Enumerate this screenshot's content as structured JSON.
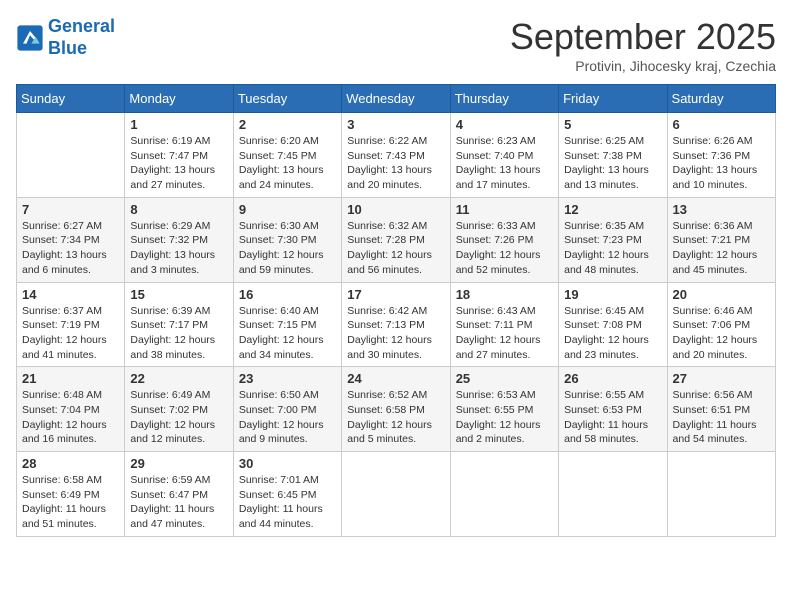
{
  "header": {
    "logo_line1": "General",
    "logo_line2": "Blue",
    "month": "September 2025",
    "location": "Protivin, Jihocesky kraj, Czechia"
  },
  "weekdays": [
    "Sunday",
    "Monday",
    "Tuesday",
    "Wednesday",
    "Thursday",
    "Friday",
    "Saturday"
  ],
  "weeks": [
    [
      {
        "day": "",
        "info": ""
      },
      {
        "day": "1",
        "info": "Sunrise: 6:19 AM\nSunset: 7:47 PM\nDaylight: 13 hours\nand 27 minutes."
      },
      {
        "day": "2",
        "info": "Sunrise: 6:20 AM\nSunset: 7:45 PM\nDaylight: 13 hours\nand 24 minutes."
      },
      {
        "day": "3",
        "info": "Sunrise: 6:22 AM\nSunset: 7:43 PM\nDaylight: 13 hours\nand 20 minutes."
      },
      {
        "day": "4",
        "info": "Sunrise: 6:23 AM\nSunset: 7:40 PM\nDaylight: 13 hours\nand 17 minutes."
      },
      {
        "day": "5",
        "info": "Sunrise: 6:25 AM\nSunset: 7:38 PM\nDaylight: 13 hours\nand 13 minutes."
      },
      {
        "day": "6",
        "info": "Sunrise: 6:26 AM\nSunset: 7:36 PM\nDaylight: 13 hours\nand 10 minutes."
      }
    ],
    [
      {
        "day": "7",
        "info": "Sunrise: 6:27 AM\nSunset: 7:34 PM\nDaylight: 13 hours\nand 6 minutes."
      },
      {
        "day": "8",
        "info": "Sunrise: 6:29 AM\nSunset: 7:32 PM\nDaylight: 13 hours\nand 3 minutes."
      },
      {
        "day": "9",
        "info": "Sunrise: 6:30 AM\nSunset: 7:30 PM\nDaylight: 12 hours\nand 59 minutes."
      },
      {
        "day": "10",
        "info": "Sunrise: 6:32 AM\nSunset: 7:28 PM\nDaylight: 12 hours\nand 56 minutes."
      },
      {
        "day": "11",
        "info": "Sunrise: 6:33 AM\nSunset: 7:26 PM\nDaylight: 12 hours\nand 52 minutes."
      },
      {
        "day": "12",
        "info": "Sunrise: 6:35 AM\nSunset: 7:23 PM\nDaylight: 12 hours\nand 48 minutes."
      },
      {
        "day": "13",
        "info": "Sunrise: 6:36 AM\nSunset: 7:21 PM\nDaylight: 12 hours\nand 45 minutes."
      }
    ],
    [
      {
        "day": "14",
        "info": "Sunrise: 6:37 AM\nSunset: 7:19 PM\nDaylight: 12 hours\nand 41 minutes."
      },
      {
        "day": "15",
        "info": "Sunrise: 6:39 AM\nSunset: 7:17 PM\nDaylight: 12 hours\nand 38 minutes."
      },
      {
        "day": "16",
        "info": "Sunrise: 6:40 AM\nSunset: 7:15 PM\nDaylight: 12 hours\nand 34 minutes."
      },
      {
        "day": "17",
        "info": "Sunrise: 6:42 AM\nSunset: 7:13 PM\nDaylight: 12 hours\nand 30 minutes."
      },
      {
        "day": "18",
        "info": "Sunrise: 6:43 AM\nSunset: 7:11 PM\nDaylight: 12 hours\nand 27 minutes."
      },
      {
        "day": "19",
        "info": "Sunrise: 6:45 AM\nSunset: 7:08 PM\nDaylight: 12 hours\nand 23 minutes."
      },
      {
        "day": "20",
        "info": "Sunrise: 6:46 AM\nSunset: 7:06 PM\nDaylight: 12 hours\nand 20 minutes."
      }
    ],
    [
      {
        "day": "21",
        "info": "Sunrise: 6:48 AM\nSunset: 7:04 PM\nDaylight: 12 hours\nand 16 minutes."
      },
      {
        "day": "22",
        "info": "Sunrise: 6:49 AM\nSunset: 7:02 PM\nDaylight: 12 hours\nand 12 minutes."
      },
      {
        "day": "23",
        "info": "Sunrise: 6:50 AM\nSunset: 7:00 PM\nDaylight: 12 hours\nand 9 minutes."
      },
      {
        "day": "24",
        "info": "Sunrise: 6:52 AM\nSunset: 6:58 PM\nDaylight: 12 hours\nand 5 minutes."
      },
      {
        "day": "25",
        "info": "Sunrise: 6:53 AM\nSunset: 6:55 PM\nDaylight: 12 hours\nand 2 minutes."
      },
      {
        "day": "26",
        "info": "Sunrise: 6:55 AM\nSunset: 6:53 PM\nDaylight: 11 hours\nand 58 minutes."
      },
      {
        "day": "27",
        "info": "Sunrise: 6:56 AM\nSunset: 6:51 PM\nDaylight: 11 hours\nand 54 minutes."
      }
    ],
    [
      {
        "day": "28",
        "info": "Sunrise: 6:58 AM\nSunset: 6:49 PM\nDaylight: 11 hours\nand 51 minutes."
      },
      {
        "day": "29",
        "info": "Sunrise: 6:59 AM\nSunset: 6:47 PM\nDaylight: 11 hours\nand 47 minutes."
      },
      {
        "day": "30",
        "info": "Sunrise: 7:01 AM\nSunset: 6:45 PM\nDaylight: 11 hours\nand 44 minutes."
      },
      {
        "day": "",
        "info": ""
      },
      {
        "day": "",
        "info": ""
      },
      {
        "day": "",
        "info": ""
      },
      {
        "day": "",
        "info": ""
      }
    ]
  ]
}
